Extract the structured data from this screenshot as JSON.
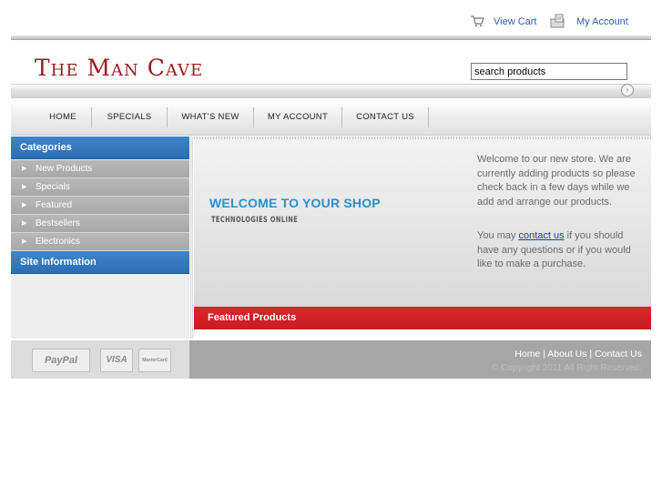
{
  "top_links": {
    "view_cart": "View Cart",
    "my_account": "My Account"
  },
  "header": {
    "logo": "The Man Cave",
    "search_value": "search products"
  },
  "nav": [
    "HOME",
    "SPECIALS",
    "WHAT'S NEW",
    "MY ACCOUNT",
    "CONTACT US"
  ],
  "sidebar": {
    "categories_title": "Categories",
    "categories": [
      "New Products",
      "Specials",
      "Featured",
      "Bestsellers",
      "Electronics"
    ],
    "site_info_title": "Site Information"
  },
  "main": {
    "welcome_title": "WELCOME TO YOUR SHOP",
    "welcome_subtitle": "TECHNOLOGIES ONLINE",
    "intro_1": "Welcome to our new store. We are currently adding products so please check back in a few days while we add and arrange our products.",
    "intro_2_before": "You may ",
    "intro_2_link": "contact us",
    "intro_2_after": " if you should have any questions or if you would like to make a purchase.",
    "featured_title": "Featured Products"
  },
  "footer": {
    "payment_cards": [
      "PayPal",
      "VISA",
      "MasterCard"
    ],
    "links": [
      "Home",
      "About Us",
      "Contact Us"
    ],
    "separator": " | ",
    "copyright": "© Copyright 2011 All Right Reserved."
  },
  "colors": {
    "brand": "#9c1a1f",
    "accent_blue": "#2b8fc7",
    "sidebar_blue": "#2a6fb3",
    "featured_red": "#d8262a"
  }
}
